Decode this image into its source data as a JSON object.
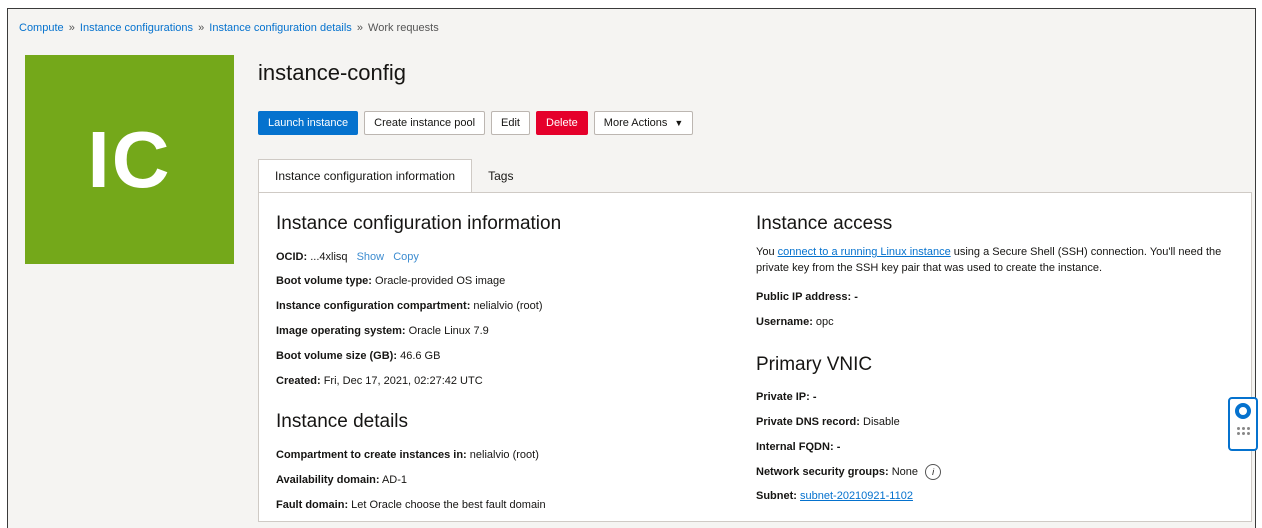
{
  "breadcrumb": {
    "items": [
      "Compute",
      "Instance configurations",
      "Instance configuration details"
    ],
    "current": "Work requests",
    "separator": "»"
  },
  "avatar": {
    "initials": "IC",
    "color": "#74a81a"
  },
  "title": "instance-config",
  "actions": {
    "launch": "Launch instance",
    "create_pool": "Create instance pool",
    "edit": "Edit",
    "delete": "Delete",
    "more": "More Actions"
  },
  "tabs": [
    {
      "label": "Instance configuration information",
      "active": true
    },
    {
      "label": "Tags",
      "active": false
    }
  ],
  "config_info": {
    "heading": "Instance configuration information",
    "ocid_label": "OCID:",
    "ocid_value": "...4xlisq",
    "show": "Show",
    "copy": "Copy",
    "boot_type_label": "Boot volume type:",
    "boot_type_value": "Oracle-provided OS image",
    "compartment_label": "Instance configuration compartment:",
    "compartment_value": "nelialvio (root)",
    "os_label": "Image operating system:",
    "os_value": "Oracle Linux 7.9",
    "boot_size_label": "Boot volume size (GB):",
    "boot_size_value": "46.6 GB",
    "created_label": "Created:",
    "created_value": "Fri, Dec 17, 2021, 02:27:42 UTC"
  },
  "instance_details": {
    "heading": "Instance details",
    "compartment_label": "Compartment to create instances in:",
    "compartment_value": "nelialvio (root)",
    "ad_label": "Availability domain:",
    "ad_value": "AD-1",
    "fault_label": "Fault domain:",
    "fault_value": "Let Oracle choose the best fault domain"
  },
  "access": {
    "heading": "Instance access",
    "text_before": "You ",
    "link": "connect to a running Linux instance",
    "text_after": " using a Secure Shell (SSH) connection. You'll need the private key from the SSH key pair that was used to create the instance.",
    "public_ip_label": "Public IP address:",
    "public_ip_value": "-",
    "username_label": "Username:",
    "username_value": "opc"
  },
  "vnic": {
    "heading": "Primary VNIC",
    "private_ip_label": "Private IP:",
    "private_ip_value": "-",
    "dns_label": "Private DNS record:",
    "dns_value": "Disable",
    "fqdn_label": "Internal FQDN:",
    "fqdn_value": "-",
    "nsg_label": "Network security groups:",
    "nsg_value": "None",
    "subnet_label": "Subnet:",
    "subnet_value": "subnet-20210921-1102"
  },
  "colors": {
    "accent": "#0572ce",
    "danger": "#e5002b",
    "avatar": "#74a81a"
  },
  "icons": {
    "info": "info-icon",
    "help": "help-ring-icon",
    "grid": "grid-dots-icon",
    "caret": "caret-down-icon"
  }
}
